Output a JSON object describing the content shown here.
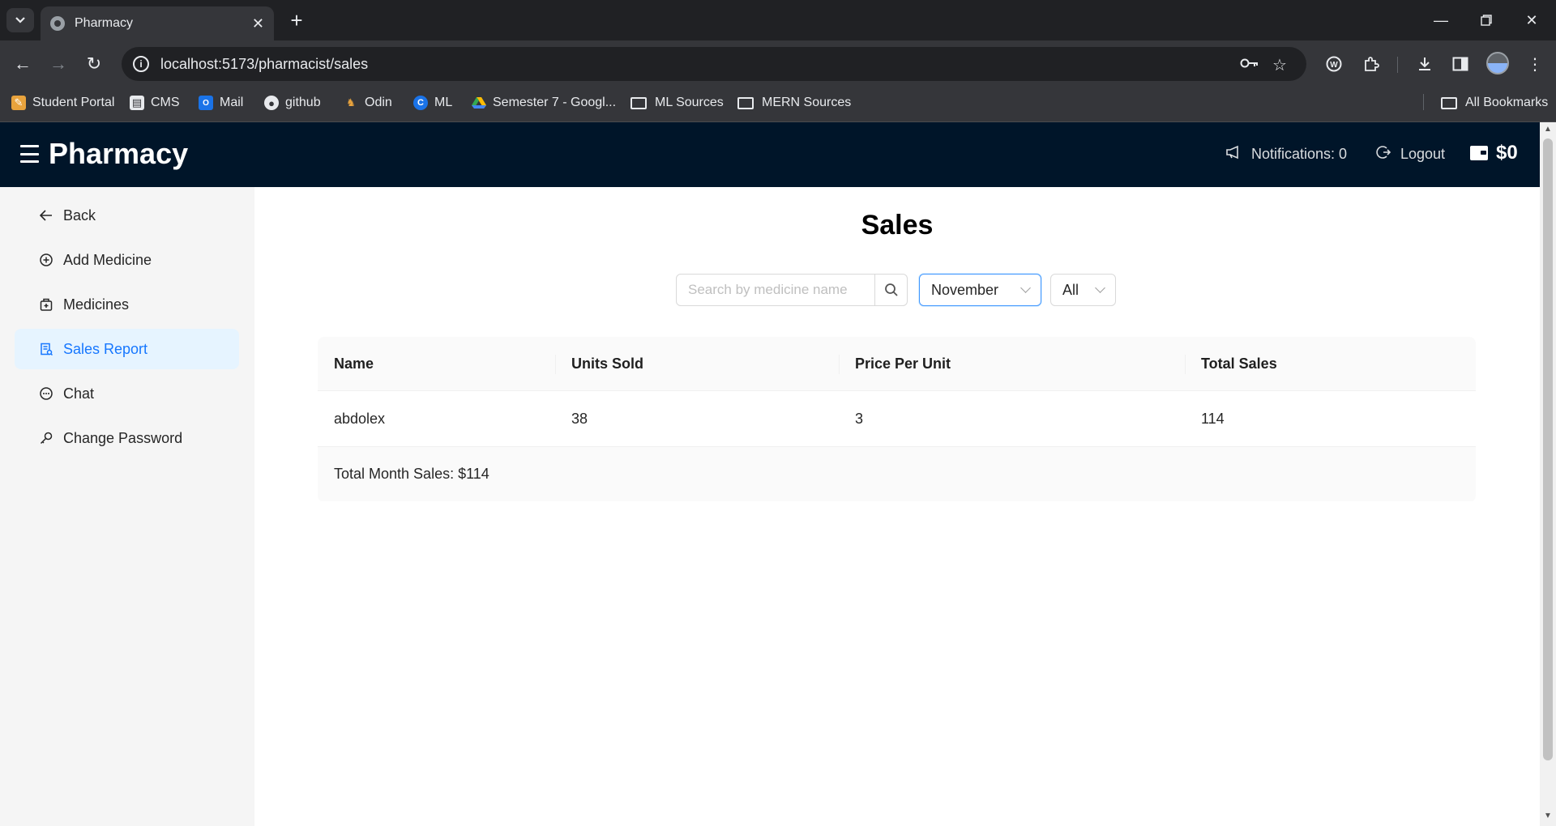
{
  "browser": {
    "tab_title": "Pharmacy",
    "url": "localhost:5173/pharmacist/sales",
    "bookmarks": [
      {
        "label": "Student Portal"
      },
      {
        "label": "CMS"
      },
      {
        "label": "Mail"
      },
      {
        "label": "github"
      },
      {
        "label": "Odin"
      },
      {
        "label": "ML"
      },
      {
        "label": "Semester 7 - Googl..."
      },
      {
        "label": "ML Sources"
      },
      {
        "label": "MERN Sources"
      }
    ],
    "all_bookmarks": "All Bookmarks"
  },
  "header": {
    "brand": "Pharmacy",
    "notifications": "Notifications: 0",
    "logout": "Logout",
    "wallet": "$0"
  },
  "sidebar": {
    "items": [
      {
        "label": "Back",
        "icon": "arrow-left-icon"
      },
      {
        "label": "Add Medicine",
        "icon": "plus-circle-icon"
      },
      {
        "label": "Medicines",
        "icon": "medicine-box-icon"
      },
      {
        "label": "Sales Report",
        "icon": "report-icon",
        "active": true
      },
      {
        "label": "Chat",
        "icon": "message-icon"
      },
      {
        "label": "Change Password",
        "icon": "key-icon"
      }
    ]
  },
  "main": {
    "title": "Sales",
    "search_placeholder": "Search by medicine name",
    "month_select": "November",
    "filter_select": "All",
    "table": {
      "columns": [
        "Name",
        "Units Sold",
        "Price Per Unit",
        "Total Sales"
      ],
      "rows": [
        {
          "name": "abdolex",
          "units": "38",
          "price": "3",
          "total": "114"
        }
      ],
      "footer": "Total Month Sales: $114"
    }
  },
  "colors": {
    "header_bg": "#001529",
    "accent": "#1677ff",
    "active_bg": "#e6f4ff"
  }
}
